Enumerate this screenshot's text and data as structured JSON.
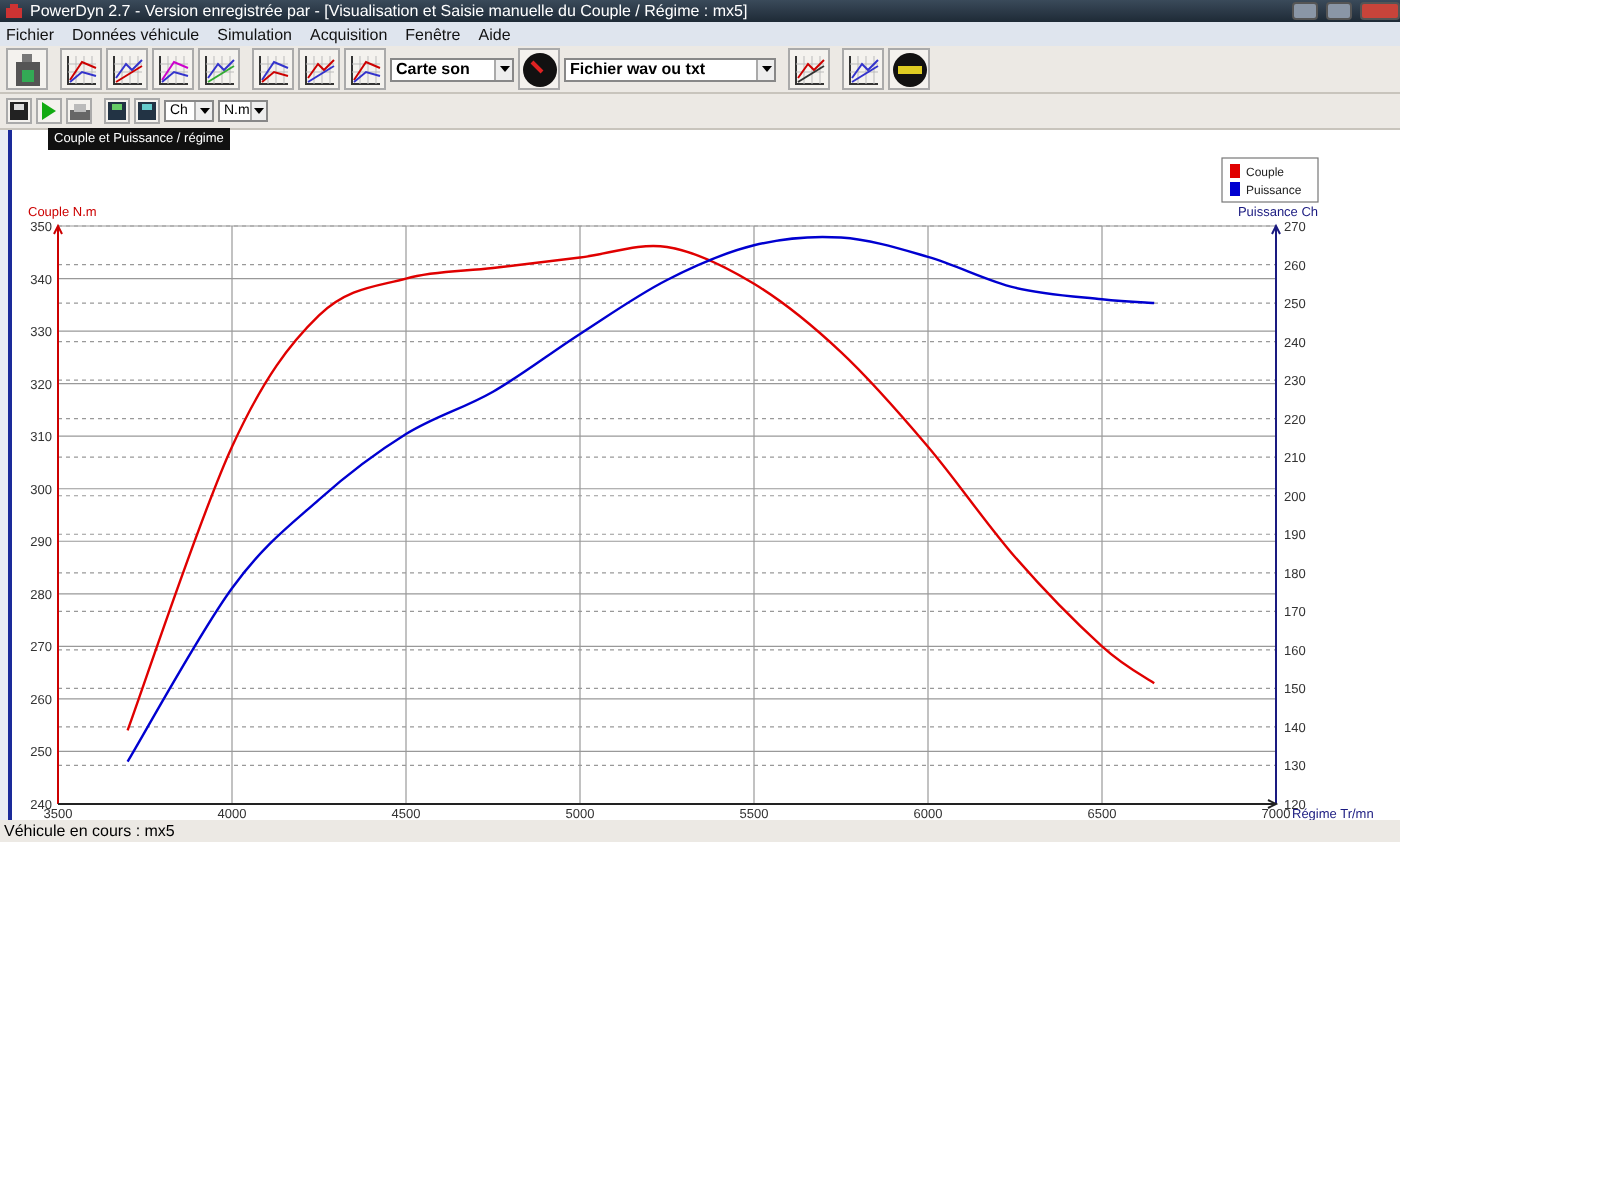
{
  "window": {
    "title": "PowerDyn 2.7 - Version enregistrée par  - [Visualisation et Saisie manuelle du Couple / Régime : mx5]"
  },
  "menu": [
    "Fichier",
    "Données véhicule",
    "Simulation",
    "Acquisition",
    "Fenêtre",
    "Aide"
  ],
  "toolbar": {
    "sound_card": "Carte son",
    "file_type": "Fichier wav ou txt"
  },
  "toolbar2": {
    "power_unit": "Ch",
    "torque_unit": "N.m",
    "tooltip": "Couple et Puissance / régime"
  },
  "chart": {
    "chart_data": {
      "type": "line",
      "ylabel": "Couple N.m",
      "y2label": "Puissance Ch",
      "xlabel": "Régime Tr/mn",
      "xlim": [
        3500,
        7000
      ],
      "grid": true,
      "legend": "top-right",
      "ylim": [
        240,
        350
      ],
      "y2lim": [
        120,
        270
      ],
      "xticks": [
        3500,
        4000,
        4500,
        5000,
        5500,
        6000,
        6500,
        7000
      ],
      "yticks": [
        240,
        250,
        260,
        270,
        280,
        290,
        300,
        310,
        320,
        330,
        340,
        350
      ],
      "y2ticks": [
        120,
        130,
        140,
        150,
        160,
        170,
        180,
        190,
        200,
        210,
        220,
        230,
        240,
        250,
        260,
        270
      ],
      "x": [
        3700,
        4000,
        4250,
        4500,
        4750,
        5000,
        5250,
        5500,
        5750,
        6000,
        6250,
        6500,
        6650
      ],
      "series": [
        {
          "name": "Couple",
          "color": "#e00000",
          "values": [
            254,
            308,
            333,
            340,
            342,
            344,
            346,
            339,
            326,
            308,
            287,
            270,
            263
          ]
        },
        {
          "name": "Puissance",
          "color": "#0000d0",
          "axis": "y2",
          "values": [
            131,
            176,
            199,
            216,
            227,
            242,
            256,
            265,
            267,
            262,
            254,
            251,
            250
          ]
        }
      ]
    }
  },
  "status_bar": "Véhicule en cours : mx5"
}
